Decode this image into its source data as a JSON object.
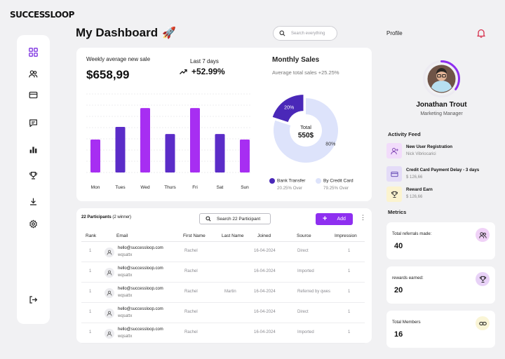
{
  "brand": {
    "logo_text": "SUCCESSLOOP"
  },
  "header": {
    "title": "My Dashboard",
    "title_emoji": "🚀",
    "search_placeholder": "Search everything",
    "profile_label": "Profile"
  },
  "sidebar": {
    "items": [
      {
        "icon": "grid-icon"
      },
      {
        "icon": "users-icon"
      },
      {
        "icon": "card-icon"
      },
      {
        "icon": "chat-icon"
      },
      {
        "icon": "bar-chart-icon"
      },
      {
        "icon": "trophy-icon"
      },
      {
        "icon": "download-icon"
      },
      {
        "icon": "settings-icon"
      },
      {
        "icon": "logout-icon"
      }
    ]
  },
  "weekly": {
    "label": "Weekly average new sale",
    "value": "$658,99",
    "period_label": "Last 7 days",
    "change": "+52.99%"
  },
  "chart_data": [
    {
      "type": "bar",
      "categories": [
        "Mon",
        "Tues",
        "Wed",
        "Thurs",
        "Fri",
        "Sat",
        "Sun"
      ],
      "values": [
        42,
        58,
        82,
        49,
        82,
        49,
        42
      ],
      "ylim": [
        0,
        100
      ],
      "grid": true,
      "colors": [
        "#a72ef2",
        "#5b2cc8",
        "#a72ef2",
        "#5b2cc8",
        "#a72ef2",
        "#5b2cc8",
        "#a72ef2"
      ]
    },
    {
      "type": "pie",
      "title": "Monthly Sales",
      "subtitle": "Average total sales +25.25%",
      "center_label": "Total",
      "center_value": "550$",
      "slices": [
        {
          "label": "Bank Transfer",
          "value": 20,
          "display": "20%",
          "note": "20.25% Over",
          "color": "#4a28b8"
        },
        {
          "label": "By Credit Card",
          "value": 80,
          "display": "80%",
          "note": "79.25% Over",
          "color": "#dde3fb"
        }
      ]
    }
  ],
  "participants": {
    "title": "22 Participants",
    "subtitle": "(2 winner)",
    "search_label": "Search 22 Participant",
    "add_label": "Add",
    "more_label": "⋮",
    "columns": [
      "Rank",
      "Email",
      "First Name",
      "Last Name",
      "Joined",
      "Source",
      "Impression"
    ],
    "rows": [
      {
        "rank": "1",
        "email": "hello@successloop.com",
        "handle": "wqsattx",
        "first": "Rachel",
        "last": "",
        "joined": "16-04-2024",
        "source": "Direct",
        "impression": "1"
      },
      {
        "rank": "1",
        "email": "hello@successloop.com",
        "handle": "wqsattx",
        "first": "Rachel",
        "last": "",
        "joined": "16-04-2024",
        "source": "Imported",
        "impression": "1"
      },
      {
        "rank": "1",
        "email": "hello@successloop.com",
        "handle": "wqsattx",
        "first": "Rachel",
        "last": "Martin",
        "joined": "16-04-2024",
        "source": "Referred by qwes",
        "impression": "1"
      },
      {
        "rank": "1",
        "email": "hello@successloop.com",
        "handle": "wqsattx",
        "first": "Rachel",
        "last": "",
        "joined": "16-04-2024",
        "source": "Direct",
        "impression": "1"
      },
      {
        "rank": "1",
        "email": "hello@successloop.com",
        "handle": "wqsattx",
        "first": "Rachel",
        "last": "",
        "joined": "16-04-2024",
        "source": "Imported",
        "impression": "1"
      }
    ]
  },
  "profile": {
    "name": "Jonathan Trout",
    "role": "Marketing Manager",
    "progress": 0.35
  },
  "activity": {
    "title": "Activity Feed",
    "items": [
      {
        "title": "New User Registration",
        "sub": "Nick Vibriocarici",
        "icon": "user-plus-icon",
        "bg": "#f2dcfb"
      },
      {
        "title": "Credit Card Payment Delay - 3 days",
        "sub": "$ 126,66",
        "icon": "card-icon",
        "bg": "#e4dcf8"
      },
      {
        "title": "Reward Earn",
        "sub": "$ 126,66",
        "icon": "trophy-icon",
        "bg": "#fbf3cf"
      }
    ]
  },
  "metrics": {
    "title": "Metrics",
    "items": [
      {
        "label": "Total referrals made:",
        "value": "40",
        "icon": "users-icon",
        "bg": "#f0d2f7"
      },
      {
        "label": "rewards earned:",
        "value": "20",
        "icon": "trophy-icon",
        "bg": "#e8d2f7"
      },
      {
        "label": "Total Members",
        "value": "16",
        "icon": "link-icon",
        "bg": "#faf5d6"
      }
    ]
  }
}
